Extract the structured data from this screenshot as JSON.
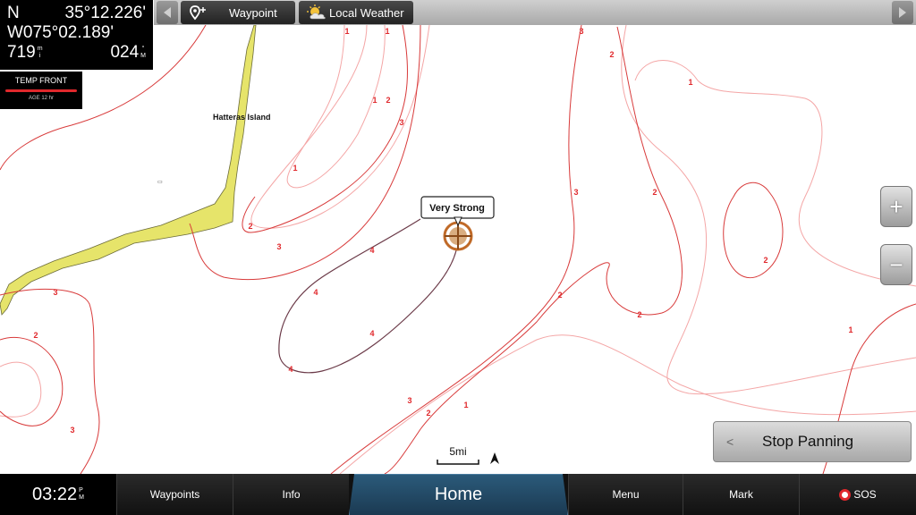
{
  "position": {
    "lat_dir": "N",
    "lat": "35°12.226'",
    "lon": "W075°02.189'",
    "distance": "719",
    "distance_unit_top": "m",
    "distance_unit_bottom": "i",
    "bearing": "024",
    "bearing_unit_top": "°",
    "bearing_unit_bottom": "M"
  },
  "temp": {
    "label": "TEMP FRONT",
    "age": "AGE 12 hr",
    "bar_color": "#e0282c"
  },
  "toolbar": {
    "waypoint_label": "Waypoint",
    "weather_label": "Local Weather"
  },
  "map": {
    "place_label": "Hatteras Island",
    "callout_text": "Very Strong",
    "scale_label": "5mi",
    "contour_color": "#e0282c",
    "contour_labels": [
      {
        "text": "1"
      },
      {
        "text": "1"
      },
      {
        "text": "3"
      },
      {
        "text": "2"
      },
      {
        "text": "1"
      },
      {
        "text": "1"
      },
      {
        "text": "2"
      },
      {
        "text": "3"
      },
      {
        "text": "1"
      },
      {
        "text": "2"
      },
      {
        "text": "3"
      },
      {
        "text": "3"
      },
      {
        "text": "2"
      },
      {
        "text": "2"
      },
      {
        "text": "2"
      },
      {
        "text": "2"
      },
      {
        "text": "1"
      },
      {
        "text": "4"
      },
      {
        "text": "4"
      },
      {
        "text": "4"
      },
      {
        "text": "4"
      },
      {
        "text": "3"
      },
      {
        "text": "2"
      },
      {
        "text": "1"
      },
      {
        "text": "3"
      },
      {
        "text": "2"
      },
      {
        "text": "3"
      }
    ]
  },
  "zoom": {
    "in_label": "+",
    "out_label": "−"
  },
  "stop_panning": {
    "label": "Stop Panning",
    "chevron": "<"
  },
  "bottom": {
    "time": "03:22",
    "ampm_top": "P",
    "ampm_bottom": "M",
    "items": [
      "Waypoints",
      "Info",
      "Home",
      "Menu",
      "Mark",
      "SOS"
    ]
  }
}
